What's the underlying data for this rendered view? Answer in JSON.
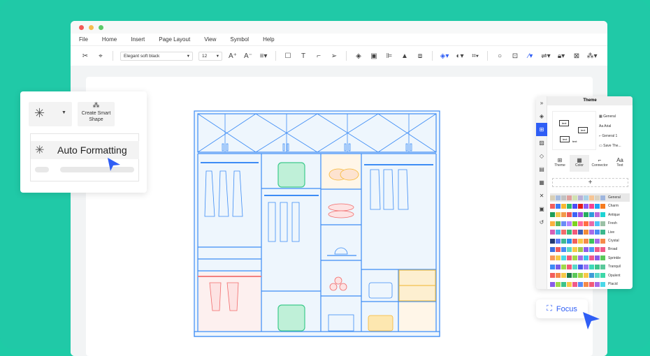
{
  "window": {
    "dots": [
      "#f25a56",
      "#f6bd4f",
      "#5cc968"
    ]
  },
  "menu": [
    "File",
    "Home",
    "Insert",
    "Page Layout",
    "View",
    "Symbol",
    "Help"
  ],
  "toolbar": {
    "font": "Elegant soft black",
    "size": "12"
  },
  "card": {
    "smart_shape": "Create Smart Shape",
    "auto_formatting": "Auto Formatting"
  },
  "panel": {
    "title": "Theme",
    "theme_items": [
      "General",
      "Arial",
      "General 1",
      "Save The..."
    ],
    "tabs": [
      "Theme",
      "Color",
      "Connector",
      "Text"
    ],
    "add": "+",
    "preview_text": [
      "text",
      "text",
      "text",
      "text"
    ],
    "palettes": [
      {
        "name": "General",
        "colors": [
          "#d8cfb8",
          "#a7bde0",
          "#c2c2c2",
          "#e0a19d",
          "#d2e2b2",
          "#b8b1d8",
          "#a9d2e6",
          "#f7c594",
          "#d9d3c3",
          "#9fb6de"
        ]
      },
      {
        "name": "Charm",
        "colors": [
          "#f25f5c",
          "#3d7cf5",
          "#f7b731",
          "#2eb872",
          "#4c4cf5",
          "#e21b1b",
          "#8a5cf5",
          "#f54291",
          "#1fa2f5",
          "#f57c1f"
        ]
      },
      {
        "name": "Antique",
        "colors": [
          "#1f9e58",
          "#f2c94c",
          "#f2994a",
          "#eb5757",
          "#3e64f5",
          "#9b51e0",
          "#27ae60",
          "#2d9cdb",
          "#bb6bd9",
          "#1dd3d3"
        ]
      },
      {
        "name": "Fresh",
        "colors": [
          "#fbb040",
          "#5cb85c",
          "#6a8cf5",
          "#b388ff",
          "#7ed321",
          "#ff6b9d",
          "#ff7043",
          "#e86aa8",
          "#4fc3f7",
          "#9bc1a6"
        ]
      },
      {
        "name": "Live",
        "colors": [
          "#d55fb7",
          "#4ab8e8",
          "#f26d6d",
          "#3cb97a",
          "#f25a7a",
          "#3d5fb9",
          "#f28c38",
          "#a66be8",
          "#4a8cf5",
          "#3ab88c"
        ]
      },
      {
        "name": "Crystal",
        "colors": [
          "#243a73",
          "#5a78f5",
          "#3fb894",
          "#2c8ff0",
          "#f25f5c",
          "#f7c948",
          "#f58a4a",
          "#3cc45a",
          "#a66be8",
          "#f58a4a"
        ]
      },
      {
        "name": "Broad",
        "colors": [
          "#3d6fe0",
          "#f05a5a",
          "#4a8cf5",
          "#5ad8c8",
          "#f7c948",
          "#a1c94a",
          "#8e5ce8",
          "#4a9cf5",
          "#f05a8a",
          "#f05a8a"
        ]
      },
      {
        "name": "Sprinkle",
        "colors": [
          "#f7985a",
          "#f7c948",
          "#4ad8e8",
          "#f25a7a",
          "#a1d84a",
          "#a66be8",
          "#3dc4e8",
          "#f05a8a",
          "#8a5ce8",
          "#5ac85a"
        ]
      },
      {
        "name": "Tranquil",
        "colors": [
          "#3d8cf5",
          "#7a5ce8",
          "#a1d84a",
          "#f25a7a",
          "#5ad8c8",
          "#4a5ce8",
          "#9a7af5",
          "#3dd8b8",
          "#3dc48a",
          "#5ac89a"
        ]
      },
      {
        "name": "Opulent",
        "colors": [
          "#f25f5c",
          "#f58a4a",
          "#f7c948",
          "#1f7a4a",
          "#5ac85a",
          "#a1d84a",
          "#f7c948",
          "#3d9cd8",
          "#5ad8c8",
          "#3dd8a8"
        ]
      },
      {
        "name": "Placid",
        "colors": [
          "#8a5ce8",
          "#a1d84a",
          "#3dc48a",
          "#f7c948",
          "#f05a8a",
          "#5a8cf5",
          "#f58a4a",
          "#f25a7a",
          "#a66be8",
          "#4ad8e8"
        ]
      }
    ]
  },
  "focus": {
    "label": "Focus"
  },
  "accent": "#2f5ef5"
}
